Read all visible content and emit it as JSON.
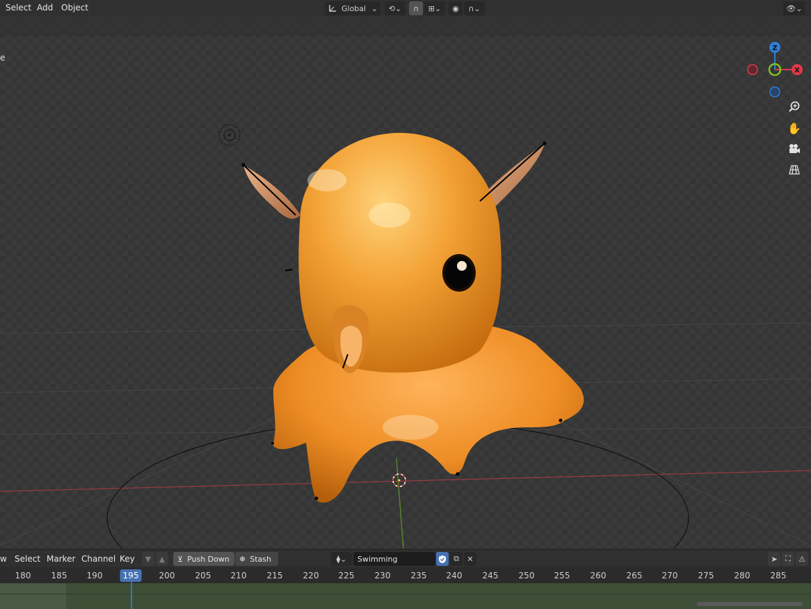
{
  "header": {
    "menu": [
      "Select",
      "Add",
      "Object"
    ],
    "orientation_label": "Global"
  },
  "viewport": {
    "edge_label": "e",
    "gizmo": {
      "z": "Z",
      "x": "X"
    },
    "nav_icons": [
      "zoom-icon",
      "hand-pan-icon",
      "camera-icon",
      "grid-icon"
    ]
  },
  "timeline": {
    "menu": [
      "w",
      "Select",
      "Marker",
      "Channel",
      "Key"
    ],
    "push_down_label": "Push Down",
    "stash_label": "Stash",
    "action_name": "Swimming",
    "current_frame": "195",
    "ticks": [
      "180",
      "185",
      "190",
      "200",
      "205",
      "210",
      "215",
      "220",
      "225",
      "230",
      "235",
      "240",
      "245",
      "250",
      "255",
      "260",
      "265",
      "270",
      "275",
      "280",
      "285"
    ]
  },
  "colors": {
    "accent": "#4772b3",
    "axis_x": "#e2384a",
    "axis_y": "#7fc31c",
    "axis_z": "#2f7ed8"
  }
}
